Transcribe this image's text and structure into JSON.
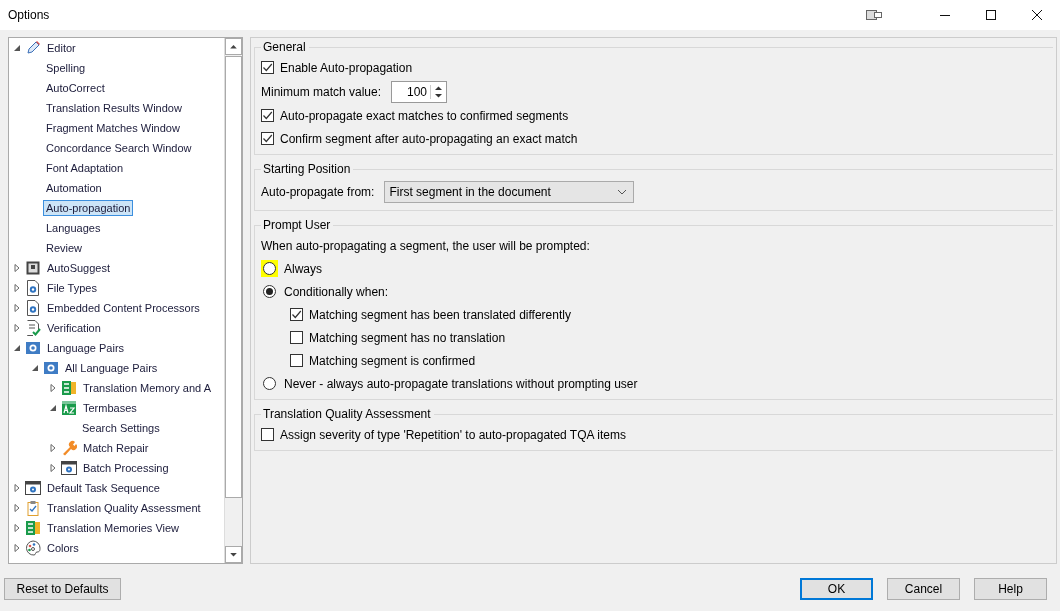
{
  "window": {
    "title": "Options"
  },
  "tree": {
    "items": [
      {
        "label": "Editor",
        "expanded": true,
        "selected": false,
        "children": [
          {
            "label": "Spelling",
            "selected": false
          },
          {
            "label": "AutoCorrect",
            "selected": false
          },
          {
            "label": "Translation Results Window",
            "selected": false
          },
          {
            "label": "Fragment Matches Window",
            "selected": false
          },
          {
            "label": "Concordance Search Window",
            "selected": false
          },
          {
            "label": "Font Adaptation",
            "selected": false
          },
          {
            "label": "Automation",
            "selected": false
          },
          {
            "label": "Auto-propagation",
            "selected": true
          },
          {
            "label": "Languages",
            "selected": false
          },
          {
            "label": "Review",
            "selected": false
          }
        ]
      },
      {
        "label": "AutoSuggest",
        "expanded": false,
        "selected": false
      },
      {
        "label": "File Types",
        "expanded": false,
        "selected": false
      },
      {
        "label": "Embedded Content Processors",
        "expanded": false,
        "selected": false
      },
      {
        "label": "Verification",
        "expanded": false,
        "selected": false
      },
      {
        "label": "Language Pairs",
        "expanded": true,
        "selected": false,
        "children": [
          {
            "label": "All Language Pairs",
            "expanded": true,
            "selected": false,
            "children": [
              {
                "label": "Translation Memory and A",
                "expanded": false,
                "selected": false
              },
              {
                "label": "Termbases",
                "expanded": true,
                "selected": false,
                "children": [
                  {
                    "label": "Search Settings",
                    "selected": false
                  }
                ]
              },
              {
                "label": "Match Repair",
                "expanded": false,
                "selected": false
              },
              {
                "label": "Batch Processing",
                "expanded": false,
                "selected": false
              }
            ]
          }
        ]
      },
      {
        "label": "Default Task Sequence",
        "expanded": false,
        "selected": false
      },
      {
        "label": "Translation Quality Assessment",
        "expanded": false,
        "selected": false
      },
      {
        "label": "Translation Memories View",
        "expanded": false,
        "selected": false
      },
      {
        "label": "Colors",
        "expanded": false,
        "selected": false
      }
    ]
  },
  "general": {
    "title": "General",
    "options": [
      {
        "kind": "checkbox",
        "label": "Enable Auto-propagation",
        "checked": true
      },
      {
        "kind": "spinner",
        "label": "Minimum match value:",
        "value": "100"
      },
      {
        "kind": "checkbox",
        "label": "Auto-propagate exact matches to confirmed segments",
        "checked": true
      },
      {
        "kind": "checkbox",
        "label": "Confirm segment after auto-propagating an exact match",
        "checked": true
      }
    ]
  },
  "starting_position": {
    "title": "Starting Position",
    "label": "Auto-propagate from:",
    "value": "First segment in the document"
  },
  "prompt_user": {
    "title": "Prompt User",
    "prompt": "When auto-propagating a segment, the user will be prompted:",
    "choices": [
      {
        "label": "Always",
        "selected": false,
        "highlighted": true
      },
      {
        "label": "Conditionally when:",
        "selected": true,
        "highlighted": false,
        "conditions": [
          {
            "label": "Matching segment has been translated differently",
            "checked": true
          },
          {
            "label": "Matching segment has no translation",
            "checked": false
          },
          {
            "label": "Matching segment is confirmed",
            "checked": false
          }
        ]
      },
      {
        "label": "Never - always auto-propagate translations without prompting user",
        "selected": false,
        "highlighted": false
      }
    ]
  },
  "tqa": {
    "title": "Translation Quality Assessment",
    "options": [
      {
        "label": "Assign severity of type 'Repetition' to auto-propagated TQA items",
        "checked": false
      }
    ]
  },
  "footer": {
    "reset": "Reset to Defaults",
    "buttons": [
      {
        "label": "OK",
        "default": true
      },
      {
        "label": "Cancel",
        "default": false
      },
      {
        "label": "Help",
        "default": false
      }
    ]
  }
}
